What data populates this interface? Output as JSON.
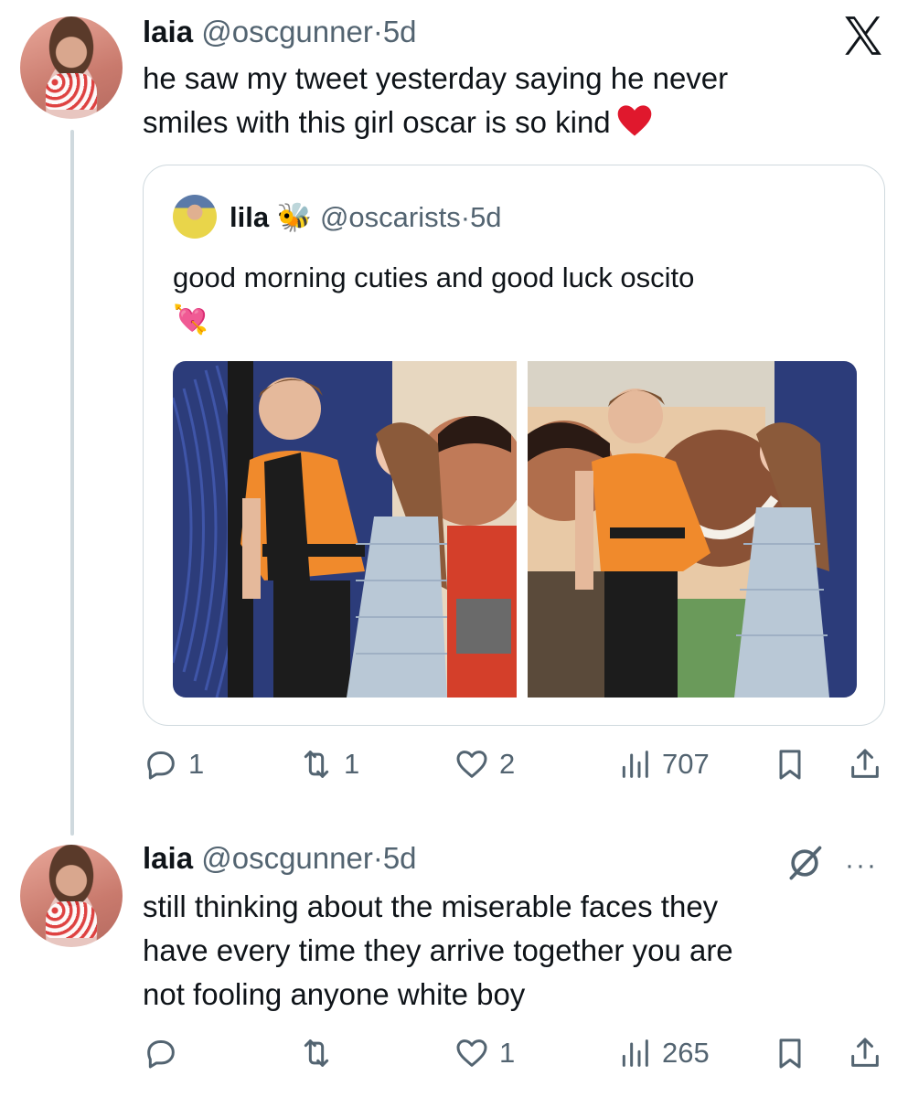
{
  "tweet1": {
    "name": "laia",
    "handle": "@oscgunner",
    "sep": "·",
    "time": "5d",
    "text_line1": "he saw my tweet yesterday saying he never",
    "text_line2": "smiles with this girl oscar is so kind",
    "emoji": "heart-emoji",
    "actions": {
      "replies": "1",
      "reposts": "1",
      "likes": "2",
      "views": "707"
    }
  },
  "quote": {
    "name": "lila",
    "name_emoji": "🐝",
    "handle": "@oscarists",
    "sep": "·",
    "time": "5d",
    "text": "good morning cuties and good luck oscito",
    "emoji": "💘"
  },
  "tweet2": {
    "name": "laia",
    "handle": "@oscgunner",
    "sep": "·",
    "time": "5d",
    "text_line1": "still thinking about the miserable faces they",
    "text_line2": "have every time they arrive together you are",
    "text_line3": "not fooling anyone white boy",
    "more": "···",
    "actions": {
      "replies": "",
      "reposts": "",
      "likes": "1",
      "views": "265"
    }
  },
  "colors": {
    "text": "#0f1419",
    "muted": "#536471",
    "border": "#cfd9de",
    "heart": "#e0182d",
    "orange": "#f08a2c"
  }
}
